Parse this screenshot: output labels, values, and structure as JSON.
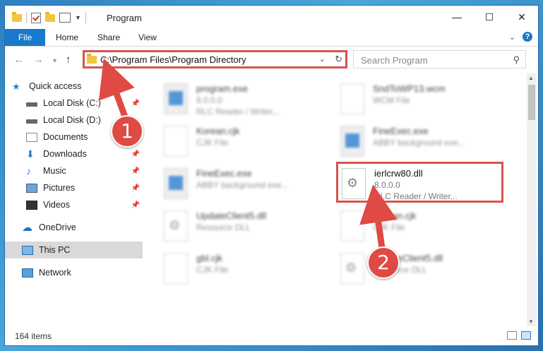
{
  "window": {
    "title": "Program"
  },
  "ribbon": {
    "tabs": [
      {
        "label": "File"
      },
      {
        "label": "Home"
      },
      {
        "label": "Share"
      },
      {
        "label": "View"
      }
    ]
  },
  "nav": {
    "address": "C:\\Program Files\\Program Directory",
    "search_placeholder": "Search Program"
  },
  "sidebar": {
    "items": [
      {
        "label": "Quick access"
      },
      {
        "label": "Local Disk (C:)"
      },
      {
        "label": "Local Disk (D:)"
      },
      {
        "label": "Documents"
      },
      {
        "label": "Downloads"
      },
      {
        "label": "Music"
      },
      {
        "label": "Pictures"
      },
      {
        "label": "Videos"
      },
      {
        "label": "OneDrive"
      },
      {
        "label": "This PC"
      },
      {
        "label": "Network"
      }
    ]
  },
  "files": [
    {
      "name": "program.exe",
      "line2": "8.0.0.0",
      "line3": "RLC Reader / Writer..."
    },
    {
      "name": "SndToWP13.wcm",
      "line2": "WCM File",
      "line3": ""
    },
    {
      "name": "Korean.cjk",
      "line2": "CJK File",
      "line3": ""
    },
    {
      "name": "FineExec.exe",
      "line2": "ABBY background exe...",
      "line3": ""
    },
    {
      "name": "FineExec.exe",
      "line2": "ABBY background exe...",
      "line3": ""
    },
    {
      "name": "ierlcrw80.dll",
      "line2": "8.0.0.0",
      "line3": "RLC Reader / Writer..."
    },
    {
      "name": "UpdateClient5.dll",
      "line2": "Resource DLL",
      "line3": ""
    },
    {
      "name": "Korean.cjk",
      "line2": "CJK File",
      "line3": ""
    },
    {
      "name": "gbl.cjk",
      "line2": "CJK File",
      "line3": ""
    },
    {
      "name": "UpdateClient5.dll",
      "line2": "Resource DLL",
      "line3": ""
    }
  ],
  "status": {
    "items_count": "164 items"
  },
  "annotations": {
    "step1": "1",
    "step2": "2",
    "color": "#e04a44"
  }
}
